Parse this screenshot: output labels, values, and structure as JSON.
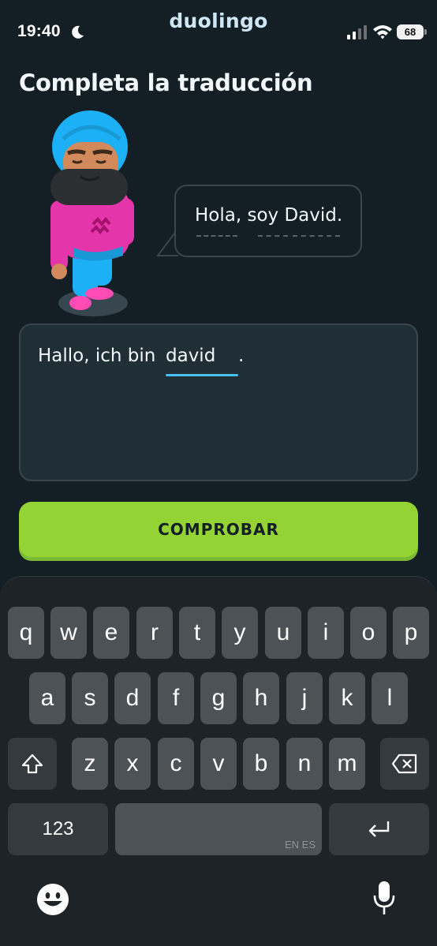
{
  "status": {
    "time": "19:40",
    "brand": "duolingo",
    "battery": "68",
    "icons": [
      "moon-icon",
      "signal-icon",
      "wifi-icon",
      "battery-icon"
    ]
  },
  "exercise": {
    "title": "Completa la traducción",
    "prompt": "Hola, soy David.",
    "answer_prefix": "Hallo, ich bin",
    "answer_input": "david",
    "answer_suffix": ".",
    "check_label": "COMPROBAR"
  },
  "keyboard": {
    "row1": [
      "q",
      "w",
      "e",
      "r",
      "t",
      "y",
      "u",
      "i",
      "o",
      "p"
    ],
    "row2": [
      "a",
      "s",
      "d",
      "f",
      "g",
      "h",
      "j",
      "k",
      "l"
    ],
    "row3": [
      "z",
      "x",
      "c",
      "v",
      "b",
      "n",
      "m"
    ],
    "numbers_label": "123",
    "space_lang": "EN ES",
    "icons": [
      "shift-icon",
      "backspace-icon",
      "return-icon",
      "emoji-icon",
      "microphone-icon"
    ]
  },
  "colors": {
    "background": "#131f24",
    "accent_green": "#93d333",
    "input_underline": "#49c0f8"
  }
}
